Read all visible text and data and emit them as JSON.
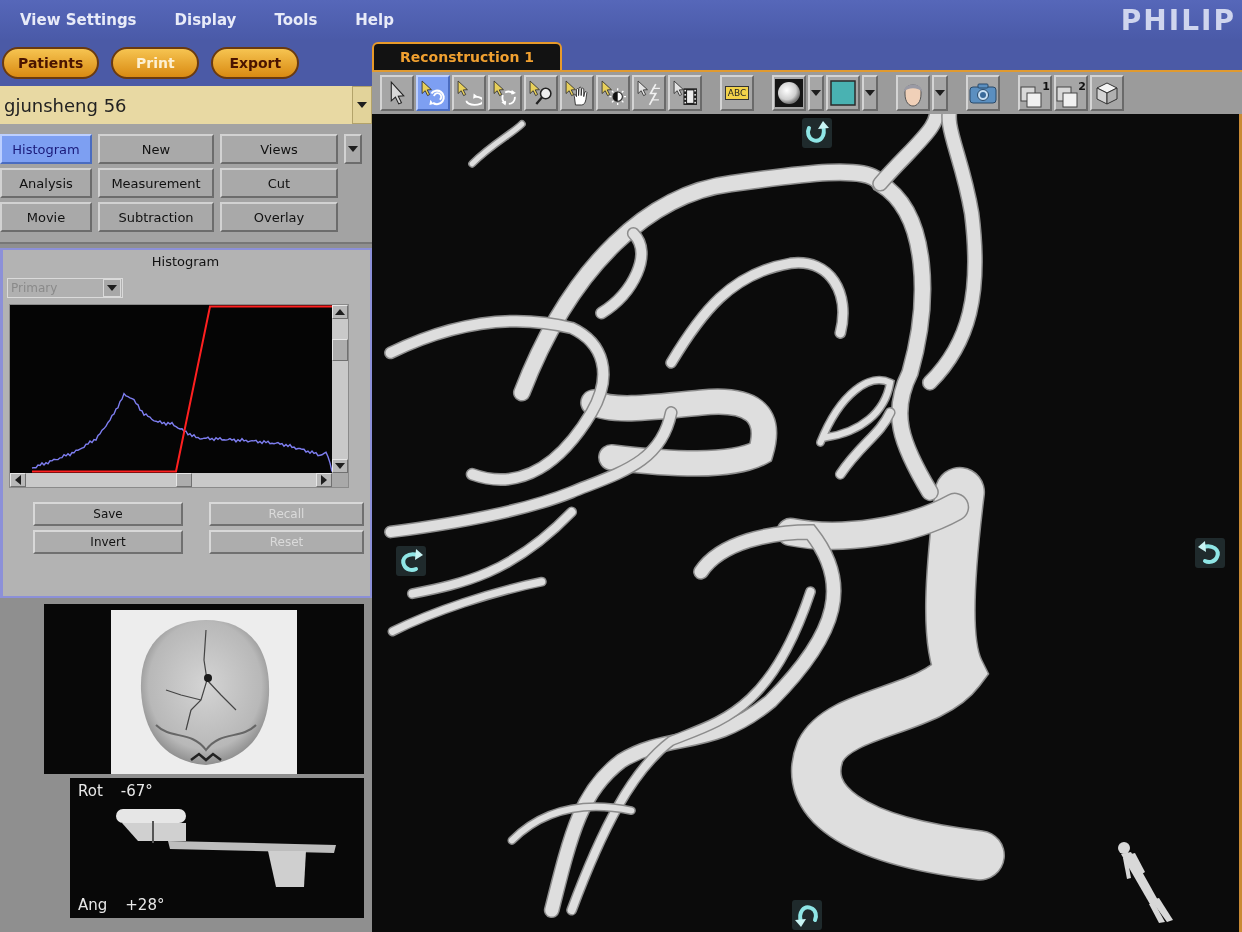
{
  "menu": [
    {
      "label": "View Settings"
    },
    {
      "label": "Display"
    },
    {
      "label": "Tools"
    },
    {
      "label": "Help"
    }
  ],
  "logo": "PHILIP",
  "action_buttons": [
    {
      "label": "Patients",
      "disabled": false
    },
    {
      "label": "Print",
      "disabled": true
    },
    {
      "label": "Export",
      "disabled": false
    }
  ],
  "patient": {
    "value": "gjunsheng 56"
  },
  "function_tabs": [
    {
      "label": "Histogram",
      "selected": true
    },
    {
      "label": "New",
      "selected": false
    },
    {
      "label": "Views",
      "selected": false
    },
    {
      "label": "Analysis",
      "selected": false
    },
    {
      "label": "Measurement",
      "selected": false
    },
    {
      "label": "Cut",
      "selected": false
    },
    {
      "label": "Movie",
      "selected": false
    },
    {
      "label": "Subtraction",
      "selected": false
    },
    {
      "label": "Overlay",
      "selected": false
    }
  ],
  "histogram_panel": {
    "title": "Histogram",
    "source": {
      "value": "Primary",
      "disabled": true
    },
    "buttons": [
      {
        "label": "Save",
        "disabled": false
      },
      {
        "label": "Recall",
        "disabled": true
      },
      {
        "label": "Invert",
        "disabled": false
      },
      {
        "label": "Reset",
        "disabled": true
      }
    ]
  },
  "geometry": {
    "rotation_label": "Rot",
    "rotation": "-67°",
    "angulation_label": "Ang",
    "angulation": "+28°"
  },
  "viewer": {
    "tabs": [
      {
        "label": "Reconstruction 1",
        "selected": true
      }
    ],
    "tools": [
      {
        "selected": false
      },
      {
        "selected": true
      },
      {
        "selected": false
      },
      {
        "selected": false
      },
      {
        "selected": false
      },
      {
        "selected": false
      },
      {
        "selected": false
      },
      {
        "selected": false
      },
      {
        "selected": false
      }
    ],
    "annotation_button": {
      "label": "ABC"
    },
    "layout_buttons": [
      {
        "label": "1"
      },
      {
        "label": "2"
      }
    ]
  }
}
